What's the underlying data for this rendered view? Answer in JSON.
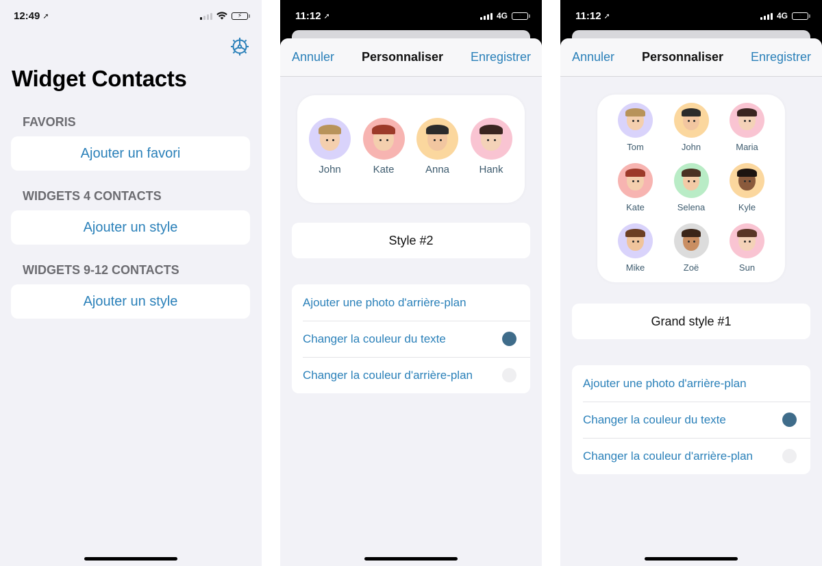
{
  "screens": [
    {
      "status": {
        "time": "12:49",
        "network": "",
        "signal_bars_active": 1
      },
      "settings_icon": "gear-icon",
      "title": "Widget Contacts",
      "sections": [
        {
          "header": "FAVORIS",
          "button": "Ajouter un favori"
        },
        {
          "header": "WIDGETS 4 CONTACTS",
          "button": "Ajouter un style"
        },
        {
          "header": "WIDGETS 9-12 CONTACTS",
          "button": "Ajouter un style"
        }
      ]
    },
    {
      "status": {
        "time": "11:12",
        "network": "4G",
        "signal_bars_active": 4
      },
      "nav": {
        "cancel": "Annuler",
        "title": "Personnaliser",
        "save": "Enregistrer"
      },
      "contacts": [
        {
          "name": "John",
          "bg": "#d9d3fb",
          "hair": "#b8935a",
          "skin": "#f4cfae"
        },
        {
          "name": "Kate",
          "bg": "#f7b4b1",
          "hair": "#9c3a2a",
          "skin": "#f4cfae"
        },
        {
          "name": "Anna",
          "bg": "#fbd79e",
          "hair": "#2b2b2b",
          "skin": "#f2c6a0"
        },
        {
          "name": "Hank",
          "bg": "#f9c4d2",
          "hair": "#3a2520",
          "skin": "#f4d2b8"
        }
      ],
      "style_name": "Style #2",
      "options": [
        {
          "label": "Ajouter une photo d'arrière-plan",
          "swatch": null
        },
        {
          "label": "Changer la couleur du texte",
          "swatch": "#3f6c8a"
        },
        {
          "label": "Changer la couleur d'arrière-plan",
          "swatch": "#efeff1"
        }
      ]
    },
    {
      "status": {
        "time": "11:12",
        "network": "4G",
        "signal_bars_active": 4
      },
      "nav": {
        "cancel": "Annuler",
        "title": "Personnaliser",
        "save": "Enregistrer"
      },
      "contacts": [
        {
          "name": "Tom",
          "bg": "#d9d3fb",
          "hair": "#b8935a",
          "skin": "#f4cfae"
        },
        {
          "name": "John",
          "bg": "#fbd79e",
          "hair": "#2b2b2b",
          "skin": "#f2c6a0"
        },
        {
          "name": "Maria",
          "bg": "#f9c4d2",
          "hair": "#3a2520",
          "skin": "#f4d2b8"
        },
        {
          "name": "Kate",
          "bg": "#f7b4b1",
          "hair": "#9c3a2a",
          "skin": "#f4cfae"
        },
        {
          "name": "Selena",
          "bg": "#b9ecc6",
          "hair": "#4a3023",
          "skin": "#f2caa6"
        },
        {
          "name": "Kyle",
          "bg": "#fbd79e",
          "hair": "#1d1410",
          "skin": "#8a5a3c"
        },
        {
          "name": "Mike",
          "bg": "#d9d3fb",
          "hair": "#6b3e24",
          "skin": "#f0c49c"
        },
        {
          "name": "Zoë",
          "bg": "#dcdcdc",
          "hair": "#3b2518",
          "skin": "#c98e62"
        },
        {
          "name": "Sun",
          "bg": "#f9c4d2",
          "hair": "#5a3626",
          "skin": "#f4d2b8"
        }
      ],
      "style_name": "Grand style #1",
      "options": [
        {
          "label": "Ajouter une photo d'arrière-plan",
          "swatch": null
        },
        {
          "label": "Changer la couleur du texte",
          "swatch": "#3f6c8a"
        },
        {
          "label": "Changer la couleur d'arrière-plan",
          "swatch": "#efeff1"
        }
      ]
    }
  ],
  "colors": {
    "accent": "#2a80b9",
    "background": "#f2f2f7",
    "name_text": "#3d5b6e"
  }
}
